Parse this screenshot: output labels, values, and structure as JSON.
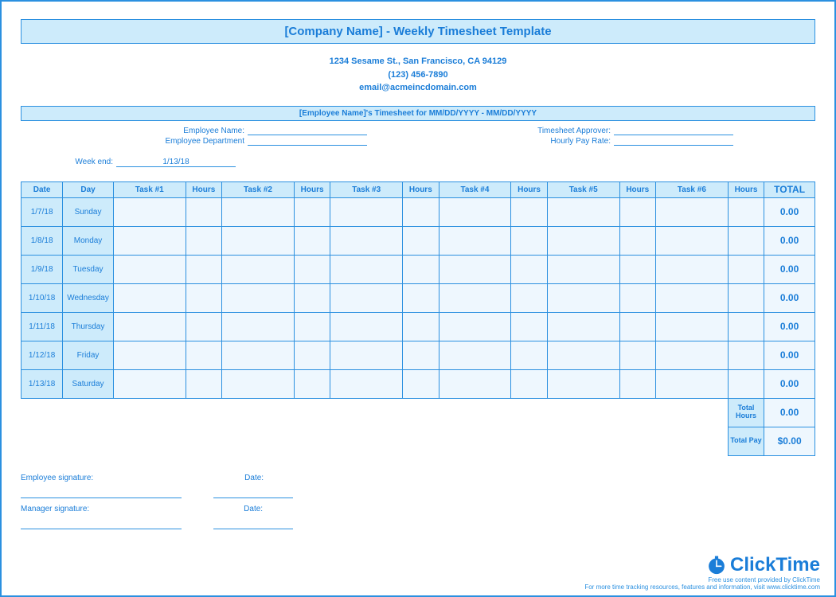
{
  "header": {
    "title": "[Company Name] - Weekly Timesheet Template",
    "address": "1234 Sesame St.,  San Francisco, CA 94129",
    "phone": "(123) 456-7890",
    "email": "email@acmeincdomain.com"
  },
  "subheader": "[Employee Name]'s Timesheet for MM/DD/YYYY - MM/DD/YYYY",
  "meta": {
    "employee_name_label": "Employee Name:",
    "employee_dept_label": "Employee Department",
    "approver_label": "Timesheet Approver:",
    "rate_label": "Hourly Pay Rate:",
    "weekend_label": "Week end:",
    "weekend_value": "1/13/18"
  },
  "columns": {
    "date": "Date",
    "day": "Day",
    "task1": "Task #1",
    "h1": "Hours",
    "task2": "Task #2",
    "h2": "Hours",
    "task3": "Task #3",
    "h3": "Hours",
    "task4": "Task #4",
    "h4": "Hours",
    "task5": "Task #5",
    "h5": "Hours",
    "task6": "Task #6",
    "h6": "Hours",
    "total": "TOTAL"
  },
  "rows": [
    {
      "date": "1/7/18",
      "day": "Sunday",
      "total": "0.00"
    },
    {
      "date": "1/8/18",
      "day": "Monday",
      "total": "0.00"
    },
    {
      "date": "1/9/18",
      "day": "Tuesday",
      "total": "0.00"
    },
    {
      "date": "1/10/18",
      "day": "Wednesday",
      "total": "0.00"
    },
    {
      "date": "1/11/18",
      "day": "Thursday",
      "total": "0.00"
    },
    {
      "date": "1/12/18",
      "day": "Friday",
      "total": "0.00"
    },
    {
      "date": "1/13/18",
      "day": "Saturday",
      "total": "0.00"
    }
  ],
  "summary": {
    "total_hours_label": "Total Hours",
    "total_hours_value": "0.00",
    "total_pay_label": "Total Pay",
    "total_pay_value": "$0.00"
  },
  "signatures": {
    "emp_label": "Employee signature:",
    "mgr_label": "Manager signature:",
    "date_label": "Date:"
  },
  "footer": {
    "brand": "ClickTime",
    "tagline": "Free use content provided by ClickTime",
    "note": "For more time tracking resources, features and information, visit www.clicktime.com"
  }
}
